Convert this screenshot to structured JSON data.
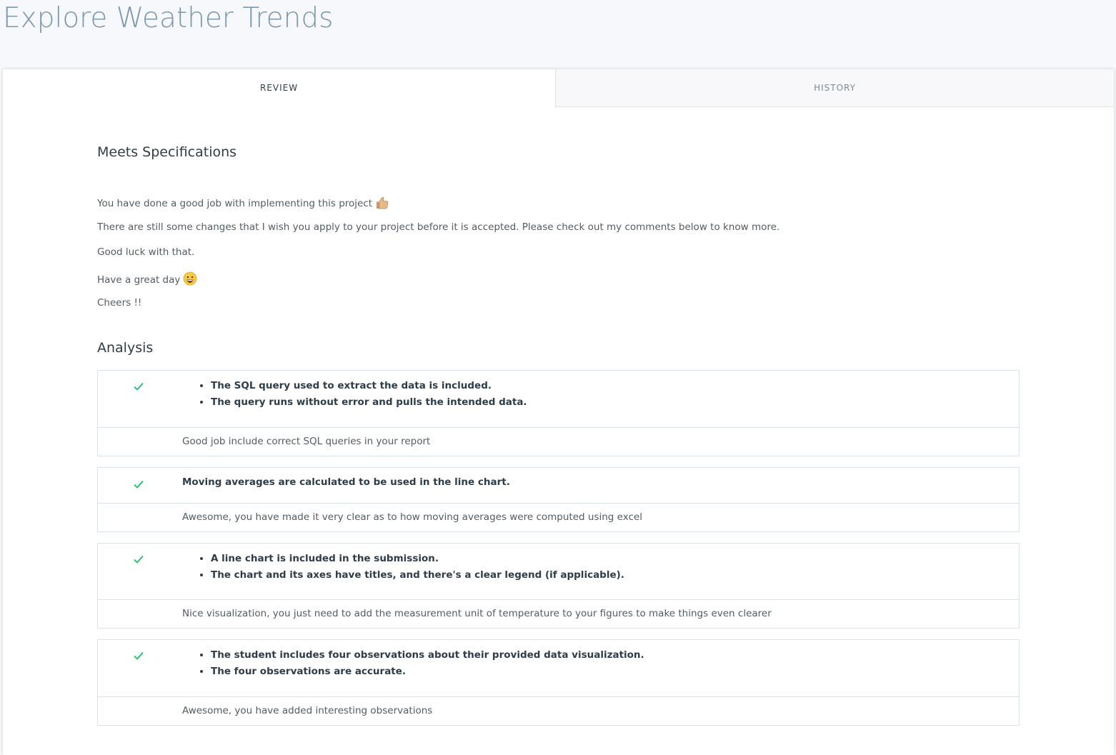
{
  "header": {
    "title": "Explore Weather Trends"
  },
  "tabs": [
    {
      "label": "REVIEW"
    },
    {
      "label": "HISTORY"
    }
  ],
  "review": {
    "result_title": "Meets Specifications",
    "messages": [
      "You have done a good job with implementing this project",
      "There are still some changes that I wish you apply to your project before it is accepted. Please check out my comments below to know more.",
      "Good luck with that.",
      "Have a great day",
      "Cheers !!"
    ]
  },
  "section": {
    "title": "Analysis"
  },
  "criteria": [
    {
      "status": "check",
      "bullets": [
        "The SQL query used to extract the data is included.",
        "The query runs without error and pulls the intended data."
      ],
      "comment": "Good job include correct SQL queries in your report"
    },
    {
      "status": "check",
      "text": "Moving averages are calculated to be used in the line chart.",
      "comment": "Awesome, you have made it very clear as to how moving averages were computed using excel"
    },
    {
      "status": "check",
      "bullets": [
        "A line chart is included in the submission.",
        "The chart and its axes have titles, and there's a clear legend (if applicable)."
      ],
      "comment": "Nice visualization, you just need to add the measurement unit of temperature to your figures to make things even clearer"
    },
    {
      "status": "check",
      "bullets": [
        "The student includes four observations about their provided data visualization.",
        "The four observations are accurate."
      ],
      "comment": "Awesome, you have added interesting observations"
    }
  ],
  "icons": {
    "thumbs_up": "thumbs-up-icon",
    "smile": "smile-icon",
    "check": "check-icon"
  },
  "colors": {
    "title": "#7d97ad",
    "check": "#02b3e4",
    "check_green": "#15c26b",
    "border": "#dbe2e8",
    "background": "#f7f8fb"
  }
}
